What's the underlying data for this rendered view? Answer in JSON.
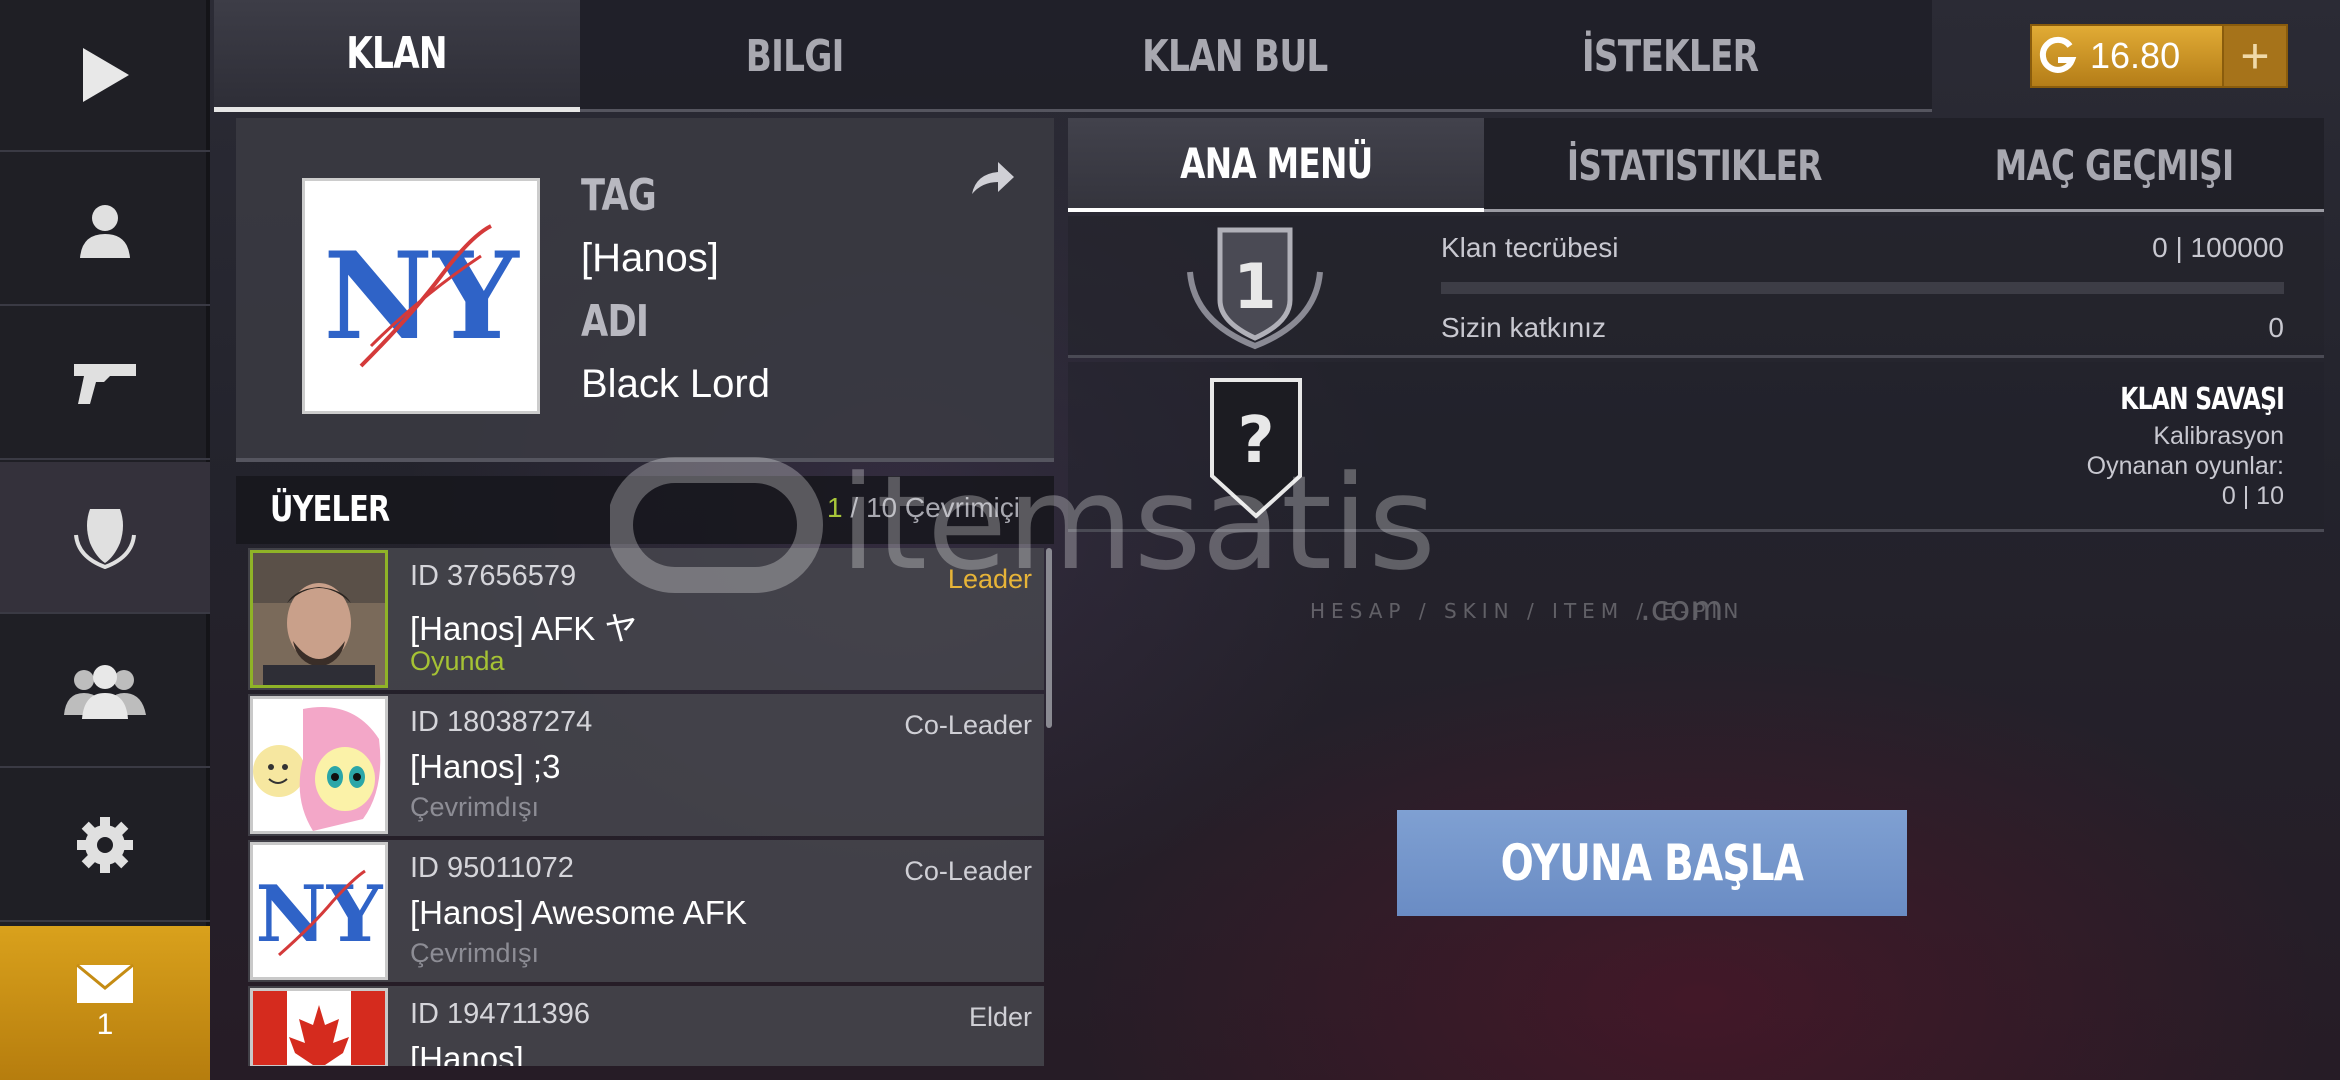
{
  "sidebar": {
    "items": [
      {
        "name": "play-icon"
      },
      {
        "name": "profile-icon"
      },
      {
        "name": "weapon-icon"
      },
      {
        "name": "clan-shield-icon"
      },
      {
        "name": "friends-icon"
      },
      {
        "name": "settings-icon"
      }
    ],
    "mail_count": "1"
  },
  "top_tabs": [
    "KLAN",
    "BILGI",
    "KLAN BUL",
    "İSTEKLER"
  ],
  "currency": {
    "amount": "16.80",
    "plus": "+"
  },
  "clan": {
    "tag_label": "TAG",
    "tag": "[Hanos]",
    "name_label": "ADI",
    "name": "Black Lord"
  },
  "members": {
    "title": "ÜYELER",
    "online_current": "1",
    "online_rest": " / 10 Çevrimiçi",
    "list": [
      {
        "id": "ID 37656579",
        "name": "[Hanos] AFK ヤ",
        "status": "Oyunda",
        "role": "Leader"
      },
      {
        "id": "ID 180387274",
        "name": "[Hanos] ;3",
        "status": "Çevrimdışı",
        "role": "Co-Leader"
      },
      {
        "id": "ID 95011072",
        "name": "[Hanos] Awesome AFK",
        "status": "Çevrimdışı",
        "role": "Co-Leader"
      },
      {
        "id": "ID 194711396",
        "name": "[Hanos] . . .",
        "status": "",
        "role": "Elder"
      }
    ]
  },
  "sub_tabs": [
    "ANA MENÜ",
    "İSTATISTIKLER",
    "MAÇ GEÇMIŞI"
  ],
  "rank": {
    "level": "1",
    "unknown": "?"
  },
  "xp": {
    "label": "Klan tecrübesi",
    "value": "0 | 100000",
    "progress": 0,
    "contrib_label": "Sizin katkınız",
    "contrib_value": "0"
  },
  "clan_war": {
    "title": "KLAN SAVAŞI",
    "status": "Kalibrasyon",
    "played_label": "Oynanan oyunlar:",
    "played_value": "0 | 10"
  },
  "play_button": "OYUNA BAŞLA",
  "watermark": {
    "brand": "itemsatis",
    "tagline": "HESAP / SKIN / ITEM / E-PIN",
    "suffix": ".com"
  },
  "colors": {
    "accent": "#d9a11c",
    "online": "#a5c234",
    "leader": "#e7b438",
    "button": "#7596cb"
  }
}
